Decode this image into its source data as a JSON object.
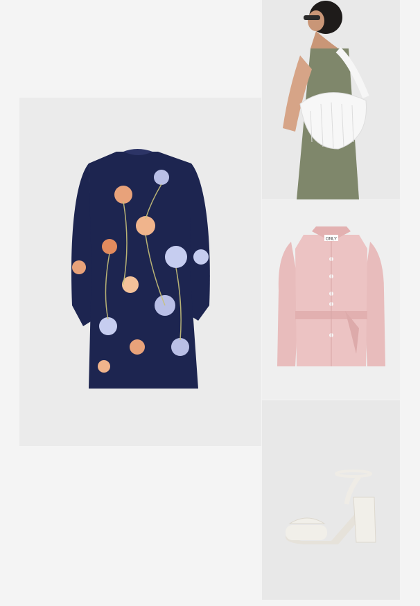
{
  "grid": {
    "items": [
      {
        "name": "floral-dress",
        "icon": "floral-dress-image",
        "color": "#1d2550"
      },
      {
        "name": "white-shoulder-bag",
        "icon": "shoulder-bag-image",
        "color": "#f7f7f7"
      },
      {
        "name": "pink-belted-jacket",
        "icon": "jacket-image",
        "color": "#e8bcbc",
        "tag_text": "ONLY"
      },
      {
        "name": "white-block-heel",
        "icon": "sandal-image",
        "color": "#f1efe9"
      }
    ]
  }
}
